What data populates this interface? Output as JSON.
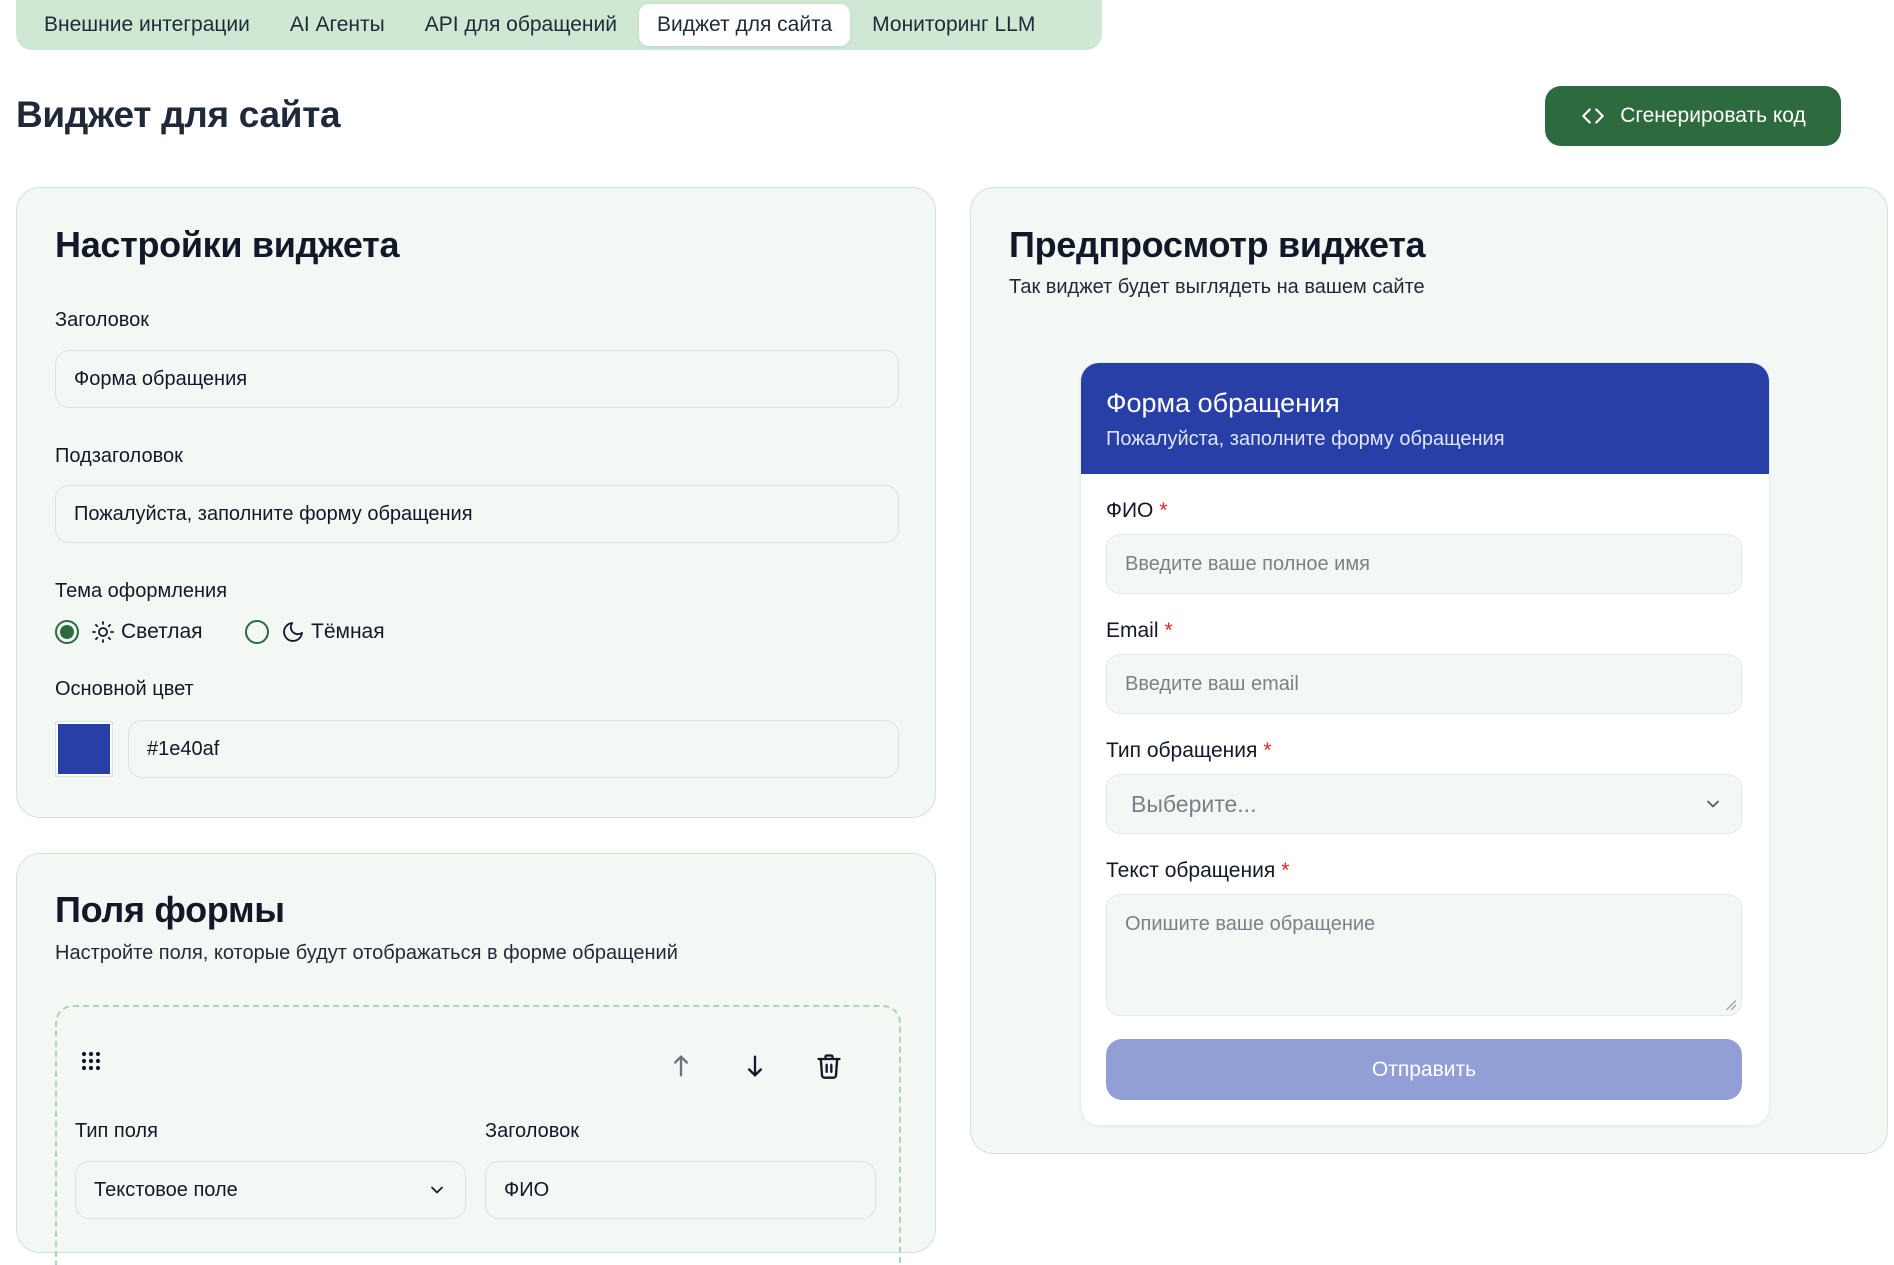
{
  "tabs": [
    {
      "label": "Внешние интеграции"
    },
    {
      "label": "AI Агенты"
    },
    {
      "label": "API для обращений"
    },
    {
      "label": "Виджет для сайта"
    },
    {
      "label": "Мониторинг LLM"
    }
  ],
  "page_title": "Виджет для сайта",
  "generate_button": "Сгенерировать код",
  "settings": {
    "title": "Настройки виджета",
    "header_label": "Заголовок",
    "header_value": "Форма обращения",
    "subheader_label": "Подзаголовок",
    "subheader_value": "Пожалуйста, заполните форму обращения",
    "theme_label": "Тема оформления",
    "theme_light": "Светлая",
    "theme_dark": "Тёмная",
    "theme_selected": "light",
    "color_label": "Основной цвет",
    "color_value": "#1e40af"
  },
  "fields": {
    "title": "Поля формы",
    "subtitle": "Настройте поля, которые будут отображаться в форме обращений",
    "item": {
      "type_label": "Тип поля",
      "type_value": "Текстовое поле",
      "header_label": "Заголовок",
      "header_value": "ФИО"
    }
  },
  "preview": {
    "title": "Предпросмотр виджета",
    "subtitle": "Так виджет будет выглядеть на вашем сайте",
    "widget": {
      "title": "Форма обращения",
      "subtitle": "Пожалуйста, заполните форму обращения",
      "fio_label": "ФИО",
      "fio_placeholder": "Введите ваше полное имя",
      "email_label": "Email",
      "email_placeholder": "Введите ваш email",
      "type_label": "Тип обращения",
      "type_placeholder": "Выберите...",
      "text_label": "Текст обращения",
      "text_placeholder": "Опишите ваше обращение",
      "required_mark": "*",
      "submit": "Отправить"
    }
  },
  "colors": {
    "accent_green": "#2d6a3e",
    "widget_primary": "#1e40af",
    "card_bg": "#f3f8f4",
    "tab_bar": "#cfe8d3"
  }
}
